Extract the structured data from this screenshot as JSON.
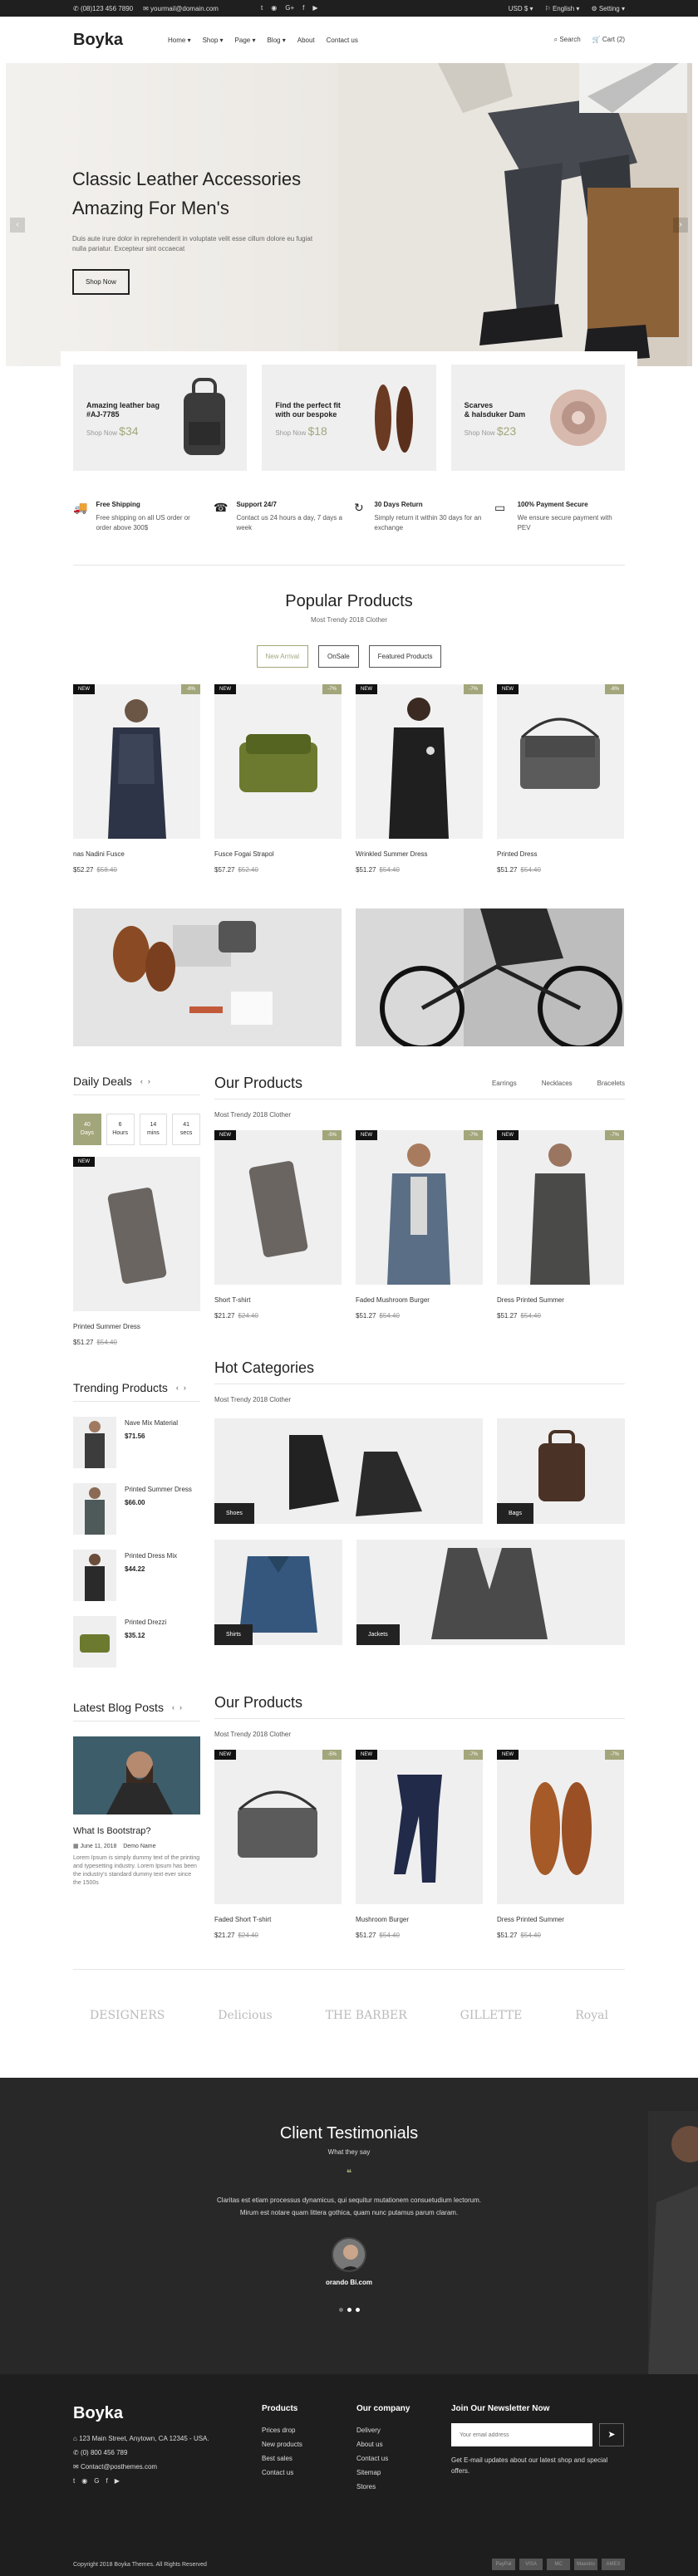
{
  "topbar": {
    "phone": "(08)123 456 7890",
    "email": "yourmail@domain.com",
    "currency": "USD $",
    "language": "English",
    "setting": "Setting"
  },
  "header": {
    "logo": "Boyka",
    "nav": [
      "Home",
      "Shop",
      "Page",
      "Blog",
      "About",
      "Contact us"
    ],
    "search": "Search",
    "cart": "Cart (2)"
  },
  "hero": {
    "title_line1": "Classic Leather Accessories",
    "title_line2": "Amazing For Men's",
    "desc": "Duis aute irure dolor in reprehenderit in voluptate velit esse cillum dolore eu fugiat nulla pariatur. Excepteur sint occaecat",
    "button": "Shop Now"
  },
  "promos": [
    {
      "line1": "Amazing leather bag",
      "line2": "#AJ-7785",
      "label": "Shop Now",
      "price": "$34"
    },
    {
      "line1": "Find the perfect fit",
      "line2": "with our bespoke",
      "label": "Shop Now",
      "price": "$18"
    },
    {
      "line1": "Scarves",
      "line2": "& halsduker Dam",
      "label": "Shop Now",
      "price": "$23"
    }
  ],
  "services": [
    {
      "title": "Free Shipping",
      "desc": "Free shipping on all US order or order above 300$"
    },
    {
      "title": "Support 24/7",
      "desc": "Contact us 24 hours a day, 7 days a week"
    },
    {
      "title": "30 Days Return",
      "desc": "Simply return it within 30 days for an exchange"
    },
    {
      "title": "100% Payment Secure",
      "desc": "We ensure secure payment with PEV"
    }
  ],
  "popular": {
    "title": "Popular Products",
    "subtitle": "Most Trendy 2018 Clother",
    "tabs": [
      "New Arrival",
      "OnSale",
      "Featured Products"
    ],
    "products": [
      {
        "new": "NEW",
        "off": "-8%",
        "name": "nas Nadini Fusce",
        "price": "$52.27",
        "old": "$58.40"
      },
      {
        "new": "NEW",
        "off": "-7%",
        "name": "Fusce Fogai Strapol",
        "price": "$57.27",
        "old": "$52.40"
      },
      {
        "new": "NEW",
        "off": "-7%",
        "name": "Wrinkled Summer Dress",
        "price": "$51.27",
        "old": "$54.40"
      },
      {
        "new": "NEW",
        "off": "-8%",
        "name": "Printed Dress",
        "price": "$51.27",
        "old": "$54.40"
      }
    ]
  },
  "daily": {
    "title": "Daily Deals",
    "countdown": [
      {
        "num": "40",
        "unit": "Days"
      },
      {
        "num": "6",
        "unit": "Hours"
      },
      {
        "num": "14",
        "unit": "mins"
      },
      {
        "num": "41",
        "unit": "secs"
      }
    ],
    "product": {
      "new": "NEW",
      "name": "Printed Summer Dress",
      "price": "$51.27",
      "old": "$54.40"
    }
  },
  "our1": {
    "title": "Our Products",
    "subtitle": "Most Trendy 2018 Clother",
    "tabs": [
      "Earrings",
      "Necklaces",
      "Bracelets"
    ],
    "products": [
      {
        "new": "NEW",
        "off": "-5%",
        "name": "Short T-shirt",
        "price": "$21.27",
        "old": "$24.40"
      },
      {
        "new": "NEW",
        "off": "-7%",
        "name": "Faded Mushroom Burger",
        "price": "$51.27",
        "old": "$54.40"
      },
      {
        "new": "NEW",
        "off": "-7%",
        "name": "Dress Printed Summer",
        "price": "$51.27",
        "old": "$54.40"
      }
    ]
  },
  "trending": {
    "title": "Trending Products",
    "items": [
      {
        "name": "Nave Mix Material",
        "price": "$71.56"
      },
      {
        "name": "Printed Summer Dress",
        "price": "$66.00"
      },
      {
        "name": "Printed Dress Mix",
        "price": "$44.22"
      },
      {
        "name": "Printed Drezzi",
        "price": "$35.12"
      }
    ]
  },
  "hotcat": {
    "title": "Hot Categories",
    "subtitle": "Most Trendy 2018 Clother",
    "cats": [
      "Shoes",
      "Bags",
      "Shirts",
      "Jackets"
    ]
  },
  "blog": {
    "title": "Latest Blog Posts",
    "post_title": "What Is Bootstrap?",
    "date": "June 11, 2018",
    "author": "Demo Name",
    "desc": "Lorem Ipsum is simply dummy text of the printing and typesetting industry. Lorem Ipsum has been the industry's standard dummy text ever since the 1500s"
  },
  "our2": {
    "title": "Our Products",
    "subtitle": "Most Trendy 2018 Clother",
    "products": [
      {
        "new": "NEW",
        "off": "-5%",
        "name": "Faded Short T-shirt",
        "price": "$21.27",
        "old": "$24.40"
      },
      {
        "new": "NEW",
        "off": "-7%",
        "name": "Mushroom Burger",
        "price": "$51.27",
        "old": "$54.40"
      },
      {
        "new": "NEW",
        "off": "-7%",
        "name": "Dress Printed Summer",
        "price": "$51.27",
        "old": "$54.40"
      }
    ]
  },
  "brands": [
    "DESIGNERS",
    "Delicious",
    "THE BARBER",
    "GILLETTE",
    "Royal"
  ],
  "testimonials": {
    "title": "Client Testimonials",
    "subtitle": "What they say",
    "quote1": "Claritas est etiam processus dynamicus, qui sequitur mutationem consuetudium lectorum.",
    "quote2": "Mirum est notare quam littera gothica, quam nunc putamus parum claram.",
    "name": "orando Bi.com"
  },
  "footer": {
    "logo": "Boyka",
    "address": "123 Main Street, Anytown, CA 12345 - USA.",
    "phone": "(0) 800 456 789",
    "email": "Contact@posthemes.com",
    "products_h": "Products",
    "products": [
      "Prices drop",
      "New products",
      "Best sales",
      "Contact us"
    ],
    "company_h": "Our company",
    "company": [
      "Delivery",
      "About us",
      "Contact us",
      "Sitemap",
      "Stores"
    ],
    "news_h": "Join Our Newsletter Now",
    "news_placeholder": "Your email address",
    "news_text": "Get E-mail updates about our latest shop and special offers.",
    "copyright": "Copyright 2018 Boyka Themes. All Rights Reserved",
    "payments": [
      "PayPal",
      "VISA",
      "MC",
      "Maestro",
      "AMEX"
    ]
  },
  "colors": {
    "accent": "#a3a67b",
    "dark": "#1f1f1f"
  }
}
